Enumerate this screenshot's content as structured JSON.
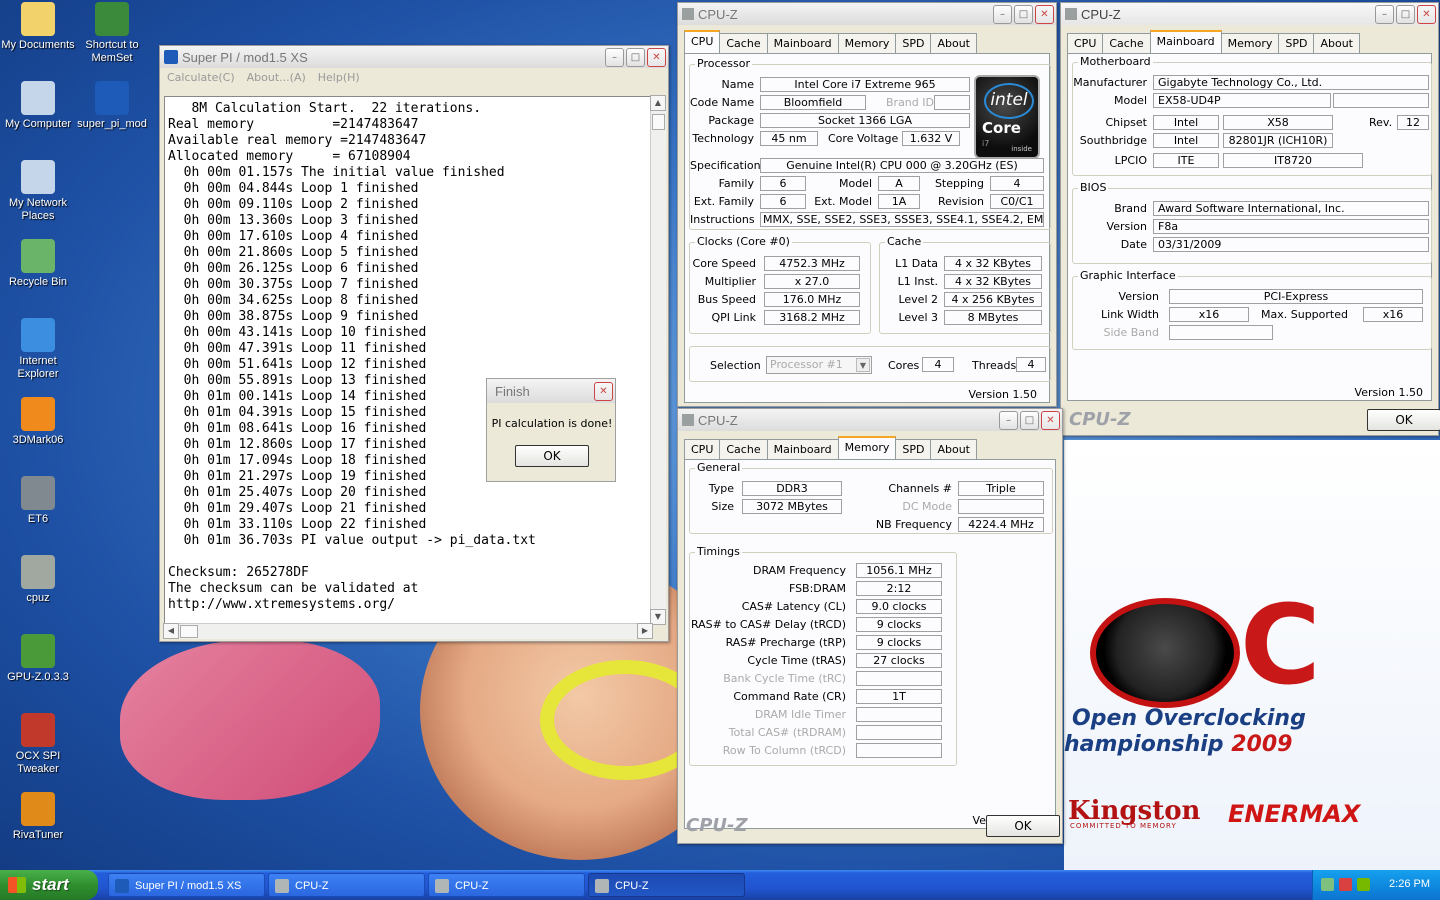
{
  "desktop": {
    "icons": [
      {
        "label": "My Documents",
        "icon": "folder-documents-icon",
        "color": "#f2d36b"
      },
      {
        "label": "Shortcut to MemSet",
        "icon": "memory-chip-icon",
        "color": "#3b8a3b"
      },
      {
        "label": "My Computer",
        "icon": "computer-icon",
        "color": "#c5d6ea"
      },
      {
        "label": "super_pi_mod",
        "icon": "super-pi-icon",
        "color": "#1e5bb8"
      },
      {
        "label": "My Network Places",
        "icon": "network-icon",
        "color": "#c5d6ea"
      },
      {
        "label": "Recycle Bin",
        "icon": "recycle-bin-icon",
        "color": "#6ab46a"
      },
      {
        "label": "Internet Explorer",
        "icon": "internet-explorer-icon",
        "color": "#3c8ee0"
      },
      {
        "label": "3DMark06",
        "icon": "3dmark-icon",
        "color": "#f08a1c"
      },
      {
        "label": "ET6",
        "icon": "et6-icon",
        "color": "#808890"
      },
      {
        "label": "cpuz",
        "icon": "cpuz-icon",
        "color": "#a0a8a0"
      },
      {
        "label": "GPU-Z.0.3.3",
        "icon": "gpuz-icon",
        "color": "#4a9a3a"
      },
      {
        "label": "OCX SPI Tweaker",
        "icon": "ocx-spi-icon",
        "color": "#c0392b"
      },
      {
        "label": "RivaTuner",
        "icon": "rivatuner-icon",
        "color": "#e08a1a"
      }
    ],
    "wallpaper": {
      "line1": "Open Overclocking",
      "line2_prefix": "hampionship",
      "year": "2009",
      "sponsor1": "Kingston",
      "sponsor1_tagline": "COMMITTED TO MEMORY",
      "sponsor2": "ENERMAX",
      "logo_letter": "C"
    }
  },
  "superpi": {
    "title": "Super PI / mod1.5 XS",
    "menu": [
      "Calculate(C)",
      "About...(A)",
      "Help(H)"
    ],
    "lines": [
      "   8M Calculation Start.  22 iterations.",
      "Real memory          =2147483647",
      "Available real memory =2147483647",
      "Allocated memory     = 67108904",
      "  0h 00m 01.157s The initial value finished",
      "  0h 00m 04.844s Loop 1 finished",
      "  0h 00m 09.110s Loop 2 finished",
      "  0h 00m 13.360s Loop 3 finished",
      "  0h 00m 17.610s Loop 4 finished",
      "  0h 00m 21.860s Loop 5 finished",
      "  0h 00m 26.125s Loop 6 finished",
      "  0h 00m 30.375s Loop 7 finished",
      "  0h 00m 34.625s Loop 8 finished",
      "  0h 00m 38.875s Loop 9 finished",
      "  0h 00m 43.141s Loop 10 finished",
      "  0h 00m 47.391s Loop 11 finished",
      "  0h 00m 51.641s Loop 12 finished",
      "  0h 00m 55.891s Loop 13 finished",
      "  0h 01m 00.141s Loop 14 finished",
      "  0h 01m 04.391s Loop 15 finished",
      "  0h 01m 08.641s Loop 16 finished",
      "  0h 01m 12.860s Loop 17 finished",
      "  0h 01m 17.094s Loop 18 finished",
      "  0h 01m 21.297s Loop 19 finished",
      "  0h 01m 25.407s Loop 20 finished",
      "  0h 01m 29.407s Loop 21 finished",
      "  0h 01m 33.110s Loop 22 finished",
      "  0h 01m 36.703s PI value output -> pi_data.txt",
      "",
      "Checksum: 265278DF",
      "The checksum can be validated at",
      "http://www.xtremesystems.org/"
    ]
  },
  "finish_dialog": {
    "title": "Finish",
    "message": "PI calculation is done!",
    "ok": "OK"
  },
  "cpuz_common": {
    "title": "CPU-Z",
    "brand": "CPU-Z",
    "version": "Version 1.50",
    "ok": "OK",
    "tabs": [
      "CPU",
      "Cache",
      "Mainboard",
      "Memory",
      "SPD",
      "About"
    ]
  },
  "cpuz_cpu": {
    "processor_group": "Processor",
    "name_label": "Name",
    "name": "Intel Core i7 Extreme 965",
    "codename_label": "Code Name",
    "codename": "Bloomfield",
    "brandid_label": "Brand ID",
    "package_label": "Package",
    "package": "Socket 1366 LGA",
    "technology_label": "Technology",
    "technology": "45 nm",
    "voltage_label": "Core Voltage",
    "voltage": "1.632 V",
    "spec_label": "Specification",
    "spec": "Genuine Intel(R) CPU         000  @ 3.20GHz (ES)",
    "family_label": "Family",
    "family": "6",
    "model_label": "Model",
    "model": "A",
    "stepping_label": "Stepping",
    "stepping": "4",
    "extfamily_label": "Ext. Family",
    "extfamily": "6",
    "extmodel_label": "Ext. Model",
    "extmodel": "1A",
    "revision_label": "Revision",
    "revision": "C0/C1",
    "instr_label": "Instructions",
    "instructions": "MMX, SSE, SSE2, SSE3, SSSE3, SSE4.1, SSE4.2, EM64T",
    "clocks_group": "Clocks (Core #0)",
    "corespeed_label": "Core Speed",
    "corespeed": "4752.3 MHz",
    "multiplier_label": "Multiplier",
    "multiplier": "x 27.0",
    "busspeed_label": "Bus Speed",
    "busspeed": "176.0 MHz",
    "qpi_label": "QPI Link",
    "qpi": "3168.2 MHz",
    "cache_group": "Cache",
    "l1d_label": "L1 Data",
    "l1d": "4 x 32 KBytes",
    "l1i_label": "L1 Inst.",
    "l1i": "4 x 32 KBytes",
    "l2_label": "Level 2",
    "l2": "4 x 256 KBytes",
    "l3_label": "Level 3",
    "l3": "8 MBytes",
    "selection_label": "Selection",
    "selection": "Processor #1",
    "cores_label": "Cores",
    "cores": "4",
    "threads_label": "Threads",
    "threads": "4",
    "logo": {
      "brand": "intel",
      "line": "Core",
      "sub": "i7",
      "inside": "inside"
    }
  },
  "cpuz_mb": {
    "mb_group": "Motherboard",
    "manufacturer_label": "Manufacturer",
    "manufacturer": "Gigabyte Technology Co., Ltd.",
    "model_label": "Model",
    "model": "EX58-UD4P",
    "chipset_label": "Chipset",
    "chipset_vendor": "Intel",
    "chipset": "X58",
    "rev_label": "Rev.",
    "rev": "12",
    "south_label": "Southbridge",
    "south_vendor": "Intel",
    "south": "82801JR (ICH10R)",
    "lpcio_label": "LPCIO",
    "lpcio_vendor": "ITE",
    "lpcio": "IT8720",
    "bios_group": "BIOS",
    "brand_label": "Brand",
    "brand": "Award Software International, Inc.",
    "version_label": "Version",
    "version": "F8a",
    "date_label": "Date",
    "date": "03/31/2009",
    "gfx_group": "Graphic Interface",
    "gfx_version_label": "Version",
    "gfx_version": "PCI-Express",
    "linkwidth_label": "Link Width",
    "linkwidth": "x16",
    "maxsup_label": "Max. Supported",
    "maxsup": "x16",
    "sideband_label": "Side Band"
  },
  "cpuz_mem": {
    "general_group": "General",
    "type_label": "Type",
    "type": "DDR3",
    "size_label": "Size",
    "size": "3072 MBytes",
    "channels_label": "Channels #",
    "channels": "Triple",
    "dcmode_label": "DC Mode",
    "nbfreq_label": "NB Frequency",
    "nbfreq": "4224.4 MHz",
    "timings_group": "Timings",
    "timings": [
      {
        "label": "DRAM Frequency",
        "value": "1056.1 MHz",
        "enabled": true
      },
      {
        "label": "FSB:DRAM",
        "value": "2:12",
        "enabled": true
      },
      {
        "label": "CAS# Latency (CL)",
        "value": "9.0 clocks",
        "enabled": true
      },
      {
        "label": "RAS# to CAS# Delay (tRCD)",
        "value": "9 clocks",
        "enabled": true
      },
      {
        "label": "RAS# Precharge (tRP)",
        "value": "9 clocks",
        "enabled": true
      },
      {
        "label": "Cycle Time (tRAS)",
        "value": "27 clocks",
        "enabled": true
      },
      {
        "label": "Bank Cycle Time (tRC)",
        "value": "",
        "enabled": false
      },
      {
        "label": "Command Rate (CR)",
        "value": "1T",
        "enabled": true
      },
      {
        "label": "DRAM Idle Timer",
        "value": "",
        "enabled": false
      },
      {
        "label": "Total CAS# (tRDRAM)",
        "value": "",
        "enabled": false
      },
      {
        "label": "Row To Column (tRCD)",
        "value": "",
        "enabled": false
      }
    ]
  },
  "taskbar": {
    "start": "start",
    "tasks": [
      {
        "label": "Super PI / mod1.5 XS",
        "active": false
      },
      {
        "label": "CPU-Z",
        "active": false
      },
      {
        "label": "CPU-Z",
        "active": false
      },
      {
        "label": "CPU-Z",
        "active": true
      }
    ],
    "clock": "2:26 PM"
  }
}
